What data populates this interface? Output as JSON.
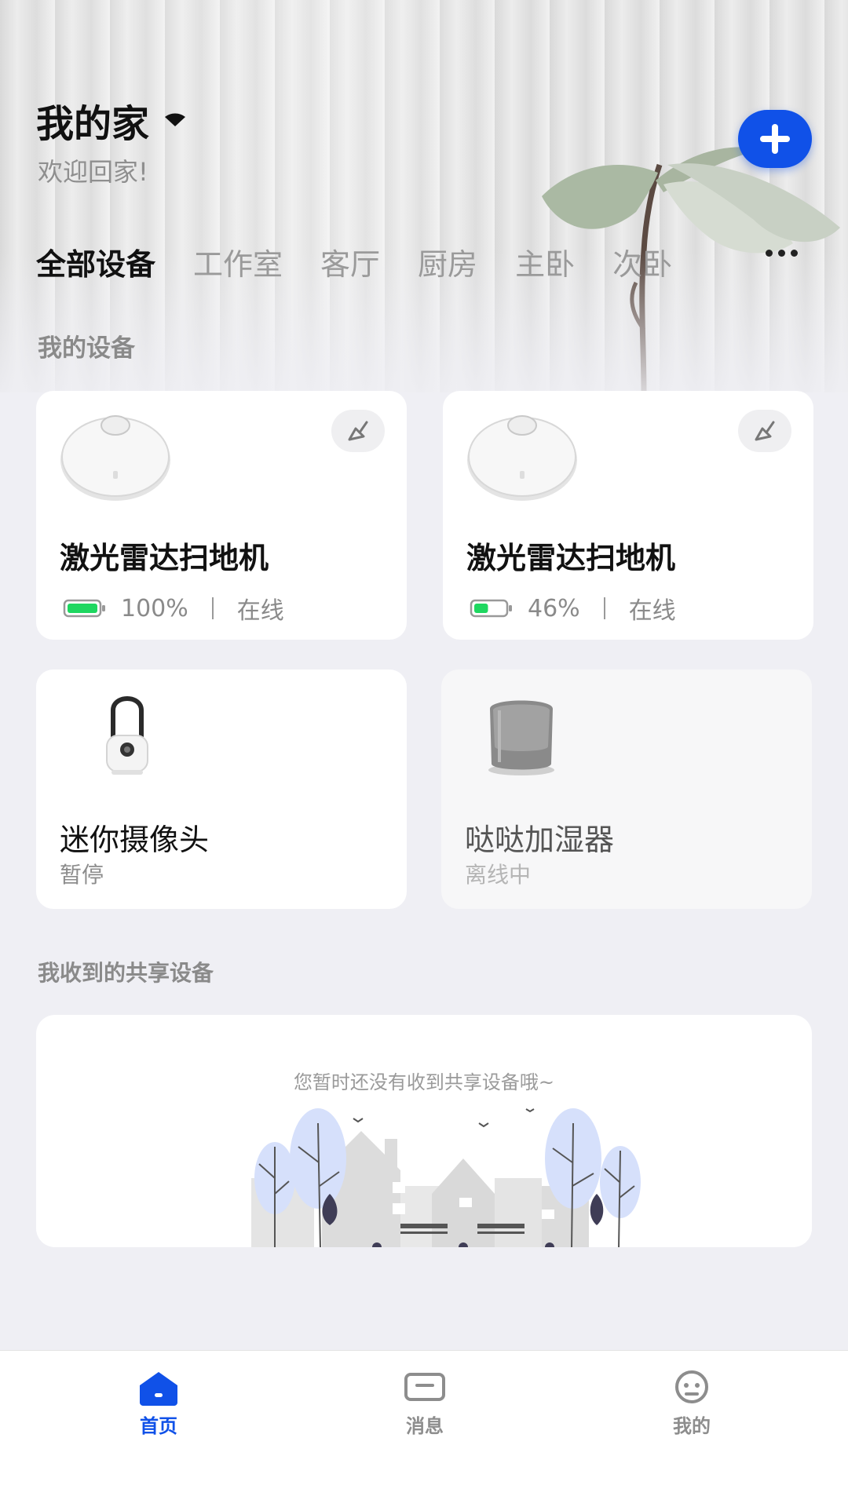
{
  "header": {
    "home_name": "我的家",
    "welcome": "欢迎回家!"
  },
  "add_button_icon": "plus-icon",
  "tabs": [
    {
      "label": "全部设备",
      "active": true
    },
    {
      "label": "工作室",
      "active": false
    },
    {
      "label": "客厅",
      "active": false
    },
    {
      "label": "厨房",
      "active": false
    },
    {
      "label": "主卧",
      "active": false
    },
    {
      "label": "次卧",
      "active": false
    }
  ],
  "sections": {
    "my_devices": "我的设备",
    "shared_devices": "我收到的共享设备"
  },
  "devices": [
    {
      "name": "激光雷达扫地机",
      "battery": "100%",
      "battery_level": 1.0,
      "status": "在线",
      "action_icon": "broom-icon"
    },
    {
      "name": "激光雷达扫地机",
      "battery": "46%",
      "battery_level": 0.46,
      "status": "在线",
      "action_icon": "broom-icon"
    },
    {
      "name": "迷你摄像头",
      "status": "暂停"
    },
    {
      "name": "哒哒加湿器",
      "status": "离线中"
    }
  ],
  "shared_empty_text": "您暂时还没有收到共享设备哦~",
  "nav": [
    {
      "label": "首页",
      "icon": "home-icon",
      "active": true
    },
    {
      "label": "消息",
      "icon": "message-icon",
      "active": false
    },
    {
      "label": "我的",
      "icon": "profile-icon",
      "active": false
    }
  ],
  "colors": {
    "accent": "#1051e8",
    "battery_green": "#1ed760"
  }
}
